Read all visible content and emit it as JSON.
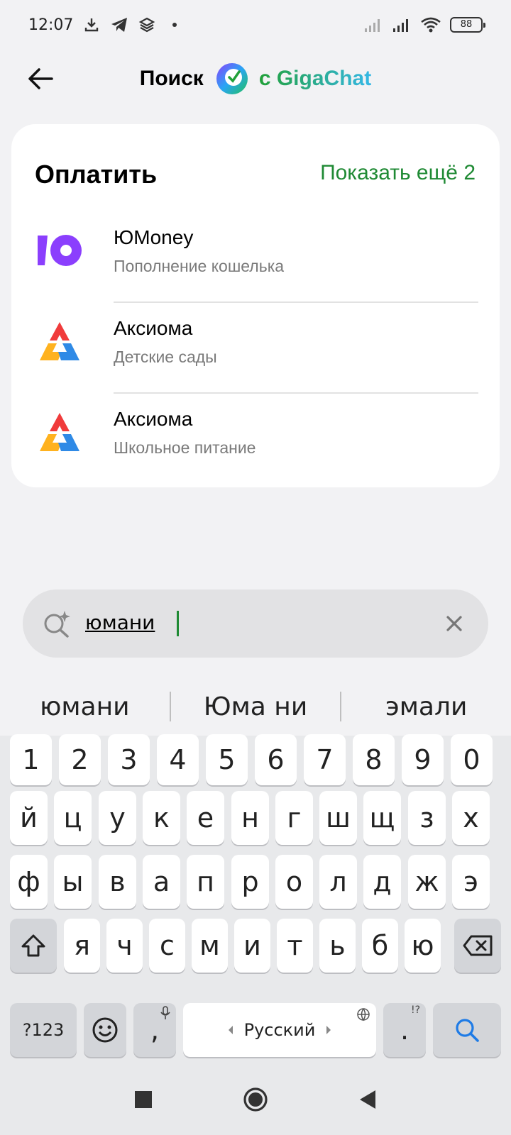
{
  "status_bar": {
    "time": "12:07",
    "battery": "88"
  },
  "header": {
    "title": "Поиск",
    "subtitle": "с GigaChat"
  },
  "section": {
    "title": "Оплатить",
    "show_more": "Показать ещё 2",
    "items": [
      {
        "name": "ЮMoney",
        "description": "Пополнение кошелька"
      },
      {
        "name": "Аксиома",
        "description": "Детские сады"
      },
      {
        "name": "Аксиома",
        "description": "Школьное питание"
      }
    ]
  },
  "search": {
    "value": "юмани"
  },
  "keyboard": {
    "suggestions": [
      "юмани",
      "Юма ни",
      "эмали"
    ],
    "row_numbers": [
      "1",
      "2",
      "3",
      "4",
      "5",
      "6",
      "7",
      "8",
      "9",
      "0"
    ],
    "row1": [
      "й",
      "ц",
      "у",
      "к",
      "е",
      "н",
      "г",
      "ш",
      "щ",
      "з",
      "х"
    ],
    "row2": [
      "ф",
      "ы",
      "в",
      "а",
      "п",
      "р",
      "о",
      "л",
      "д",
      "ж",
      "э"
    ],
    "row3": [
      "я",
      "ч",
      "с",
      "м",
      "и",
      "т",
      "ь",
      "б",
      "ю"
    ],
    "symbols_key": "?123",
    "comma": ",",
    "space_label": "Русский",
    "period": ".",
    "period_hint": "!?"
  },
  "colors": {
    "accent_green": "#1f8a34",
    "background": "#f2f2f4"
  }
}
